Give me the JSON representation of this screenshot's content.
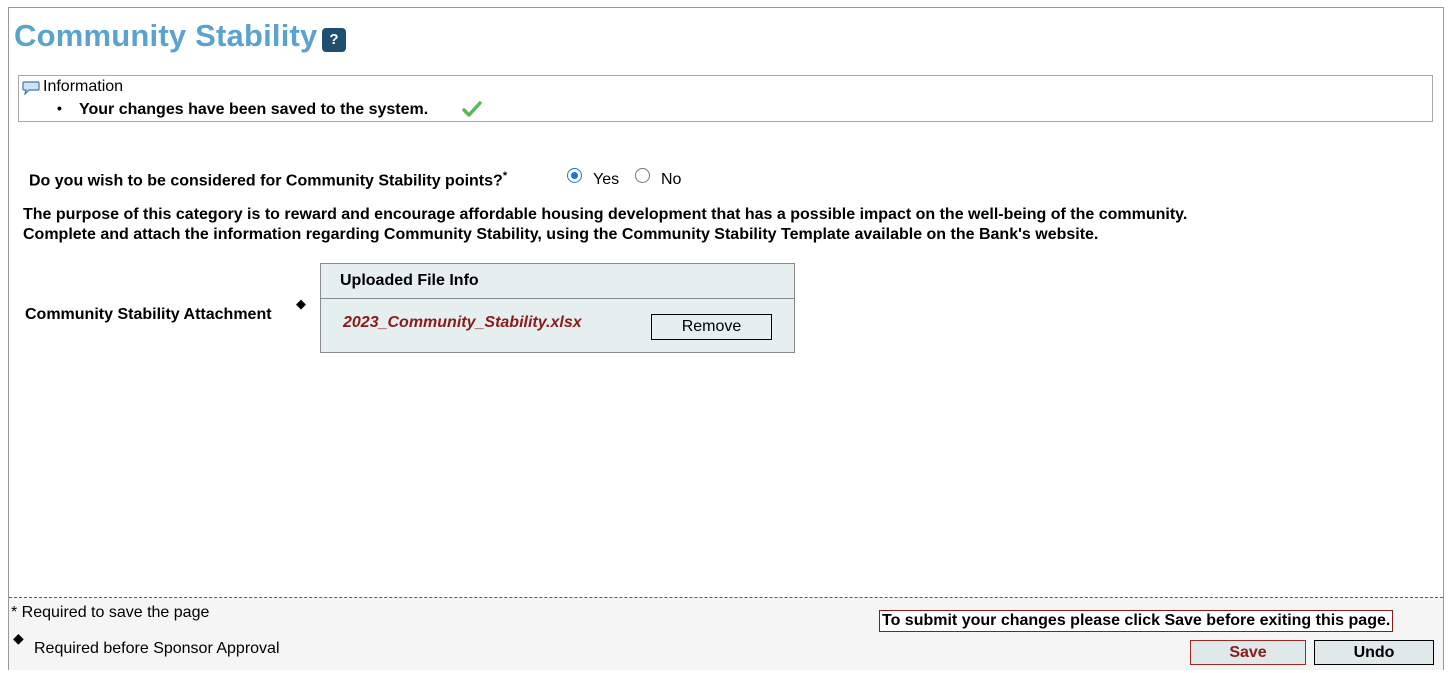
{
  "page": {
    "title": "Community Stability",
    "help_icon": "question-mark-icon"
  },
  "info": {
    "icon": "speech-bubble-icon",
    "title": "Information",
    "bullet": "•",
    "message": "Your changes have been saved to the system.",
    "status_icon": "checkmark-icon",
    "status_color": "#5cb85c"
  },
  "question": {
    "text": "Do you wish to be considered for Community Stability points?",
    "required_marker": "*",
    "options": [
      {
        "label": "Yes",
        "selected": true
      },
      {
        "label": "No",
        "selected": false
      }
    ]
  },
  "description": {
    "line1": "The purpose of this category is to reward and encourage affordable housing development that has a possible impact on the well-being of the community.",
    "line2": "Complete and attach the information regarding Community Stability, using the Community Stability Template available on the Bank's website."
  },
  "attachment": {
    "label": "Community Stability Attachment",
    "marker": "◆",
    "header": "Uploaded File Info",
    "file_name": "2023_Community_Stability.xlsx",
    "remove_label": "Remove"
  },
  "footer": {
    "required_save": "* Required to save the page",
    "required_sponsor_marker": "◆",
    "required_sponsor": "Required before Sponsor Approval",
    "submit_note": "To submit your changes please click Save before exiting this page.",
    "save_label": "Save",
    "undo_label": "Undo"
  },
  "colors": {
    "title": "#5ba3cf",
    "accent_red": "#8b1a1a",
    "panel_bg": "#e6eff0"
  }
}
